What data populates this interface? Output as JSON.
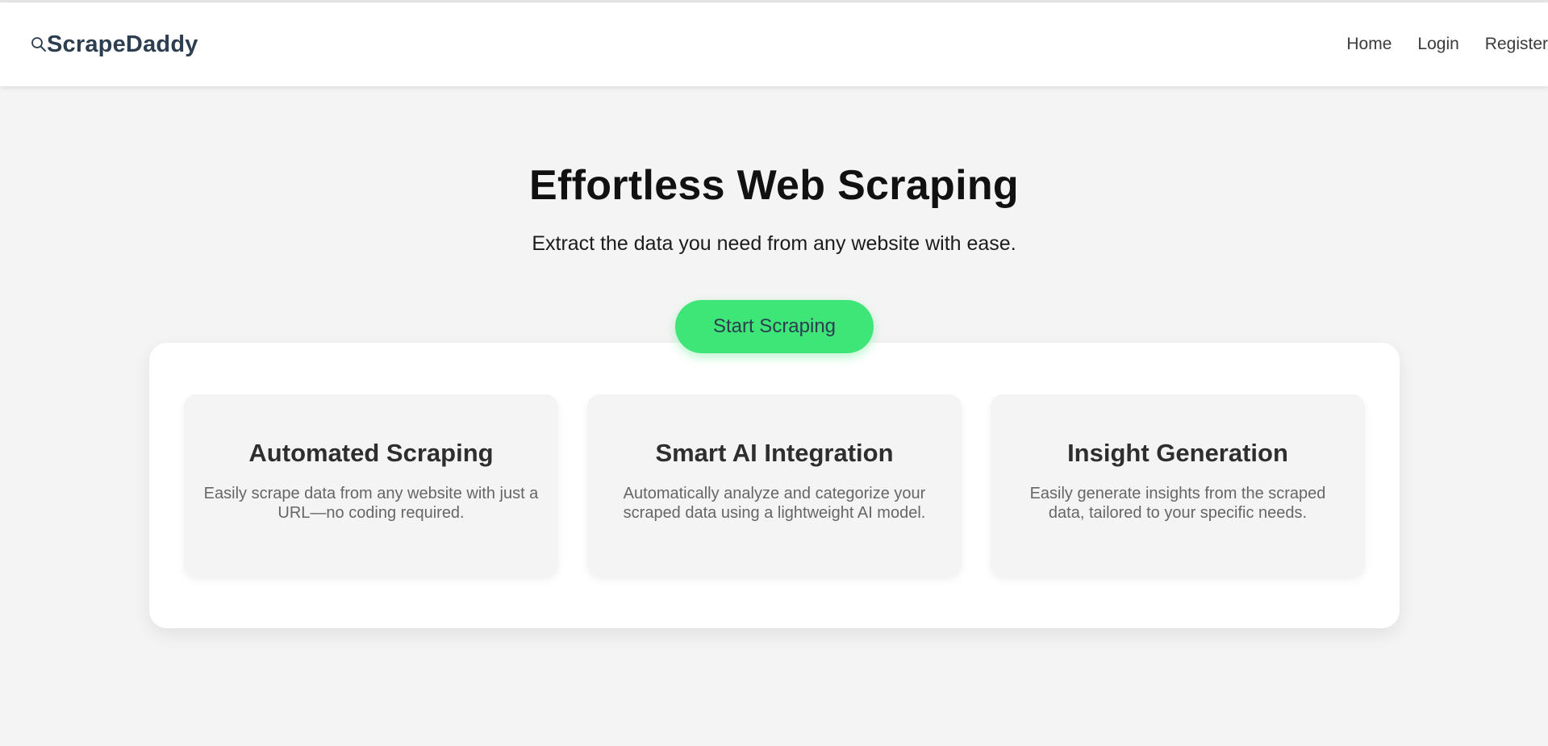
{
  "navbar": {
    "brand": "ScrapeDaddy",
    "brand_icon": "search-icon",
    "links": [
      "Home",
      "Login",
      "Register"
    ]
  },
  "hero": {
    "title": "Effortless Web Scraping",
    "subtitle": "Extract the data you need from any website with ease.",
    "cta_label": "Start Scraping"
  },
  "features": [
    {
      "title": "Automated Scraping",
      "text": "Easily scrape data from any website with just a URL—no coding required."
    },
    {
      "title": "Smart AI Integration",
      "text": "Automatically analyze and categorize your scraped data using a lightweight AI model."
    },
    {
      "title": "Insight Generation",
      "text": "Easily generate insights from the scraped data, tailored to your specific needs."
    }
  ],
  "colors": {
    "accent": "#3ee577",
    "brand": "#2c3e50",
    "background": "#f4f4f4"
  }
}
